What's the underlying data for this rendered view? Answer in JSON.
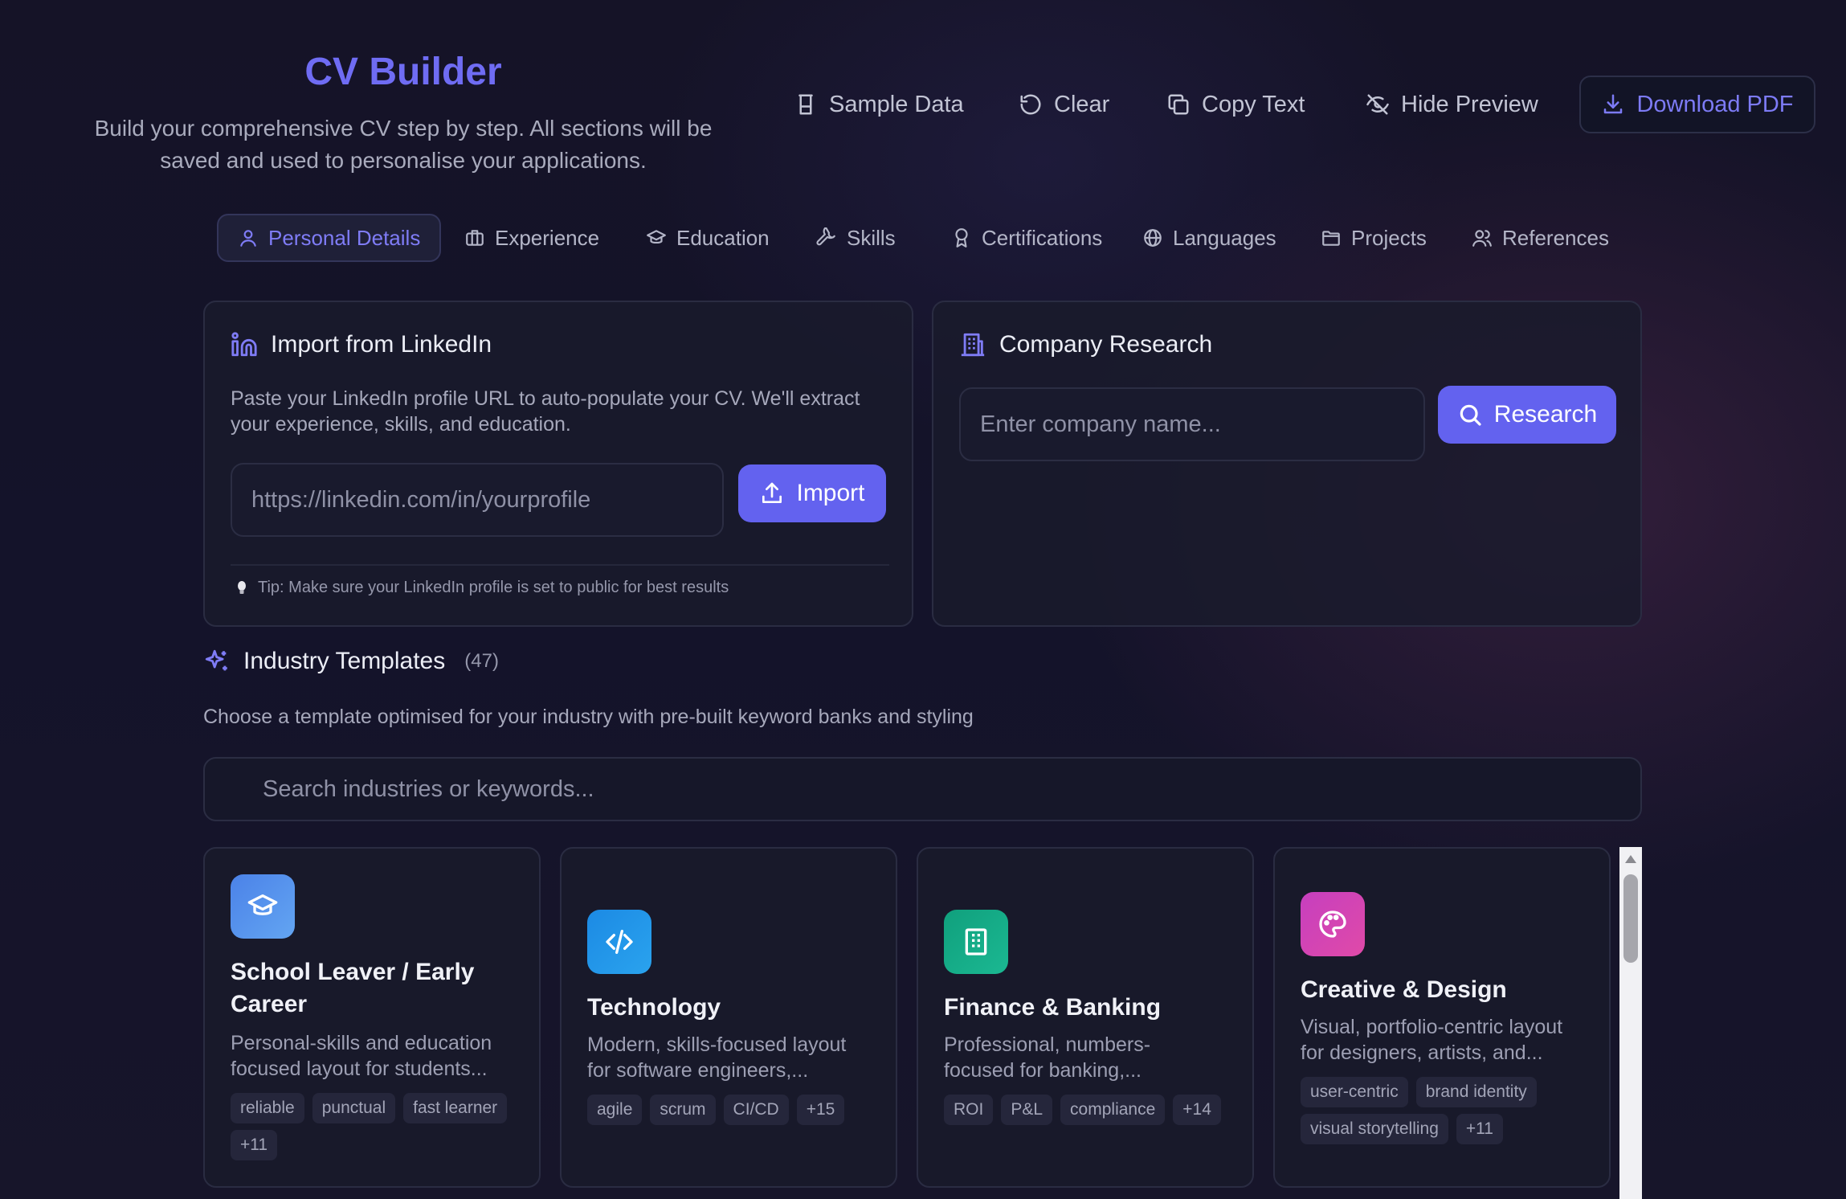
{
  "header": {
    "title": "CV Builder",
    "subtitle_line1": "Build your comprehensive CV step by step. All sections will be",
    "subtitle_line2": "saved and used to personalise your applications.",
    "actions": {
      "sample": "Sample Data",
      "clear": "Clear",
      "copy": "Copy Text",
      "hide": "Hide Preview",
      "download": "Download PDF"
    }
  },
  "tabs": [
    {
      "label": "Personal Details",
      "icon": "user-icon",
      "active": true
    },
    {
      "label": "Experience",
      "icon": "briefcase-icon"
    },
    {
      "label": "Education",
      "icon": "graduation-cap-icon"
    },
    {
      "label": "Skills",
      "icon": "wrench-icon"
    },
    {
      "label": "Certifications",
      "icon": "award-icon"
    },
    {
      "label": "Languages",
      "icon": "globe-icon"
    },
    {
      "label": "Projects",
      "icon": "folder-icon"
    },
    {
      "label": "References",
      "icon": "users-icon"
    }
  ],
  "linkedin": {
    "title": "Import from LinkedIn",
    "desc_line1": "Paste your LinkedIn profile URL to auto-populate your CV. We'll extract",
    "desc_line2": "your experience, skills, and education.",
    "placeholder": "https://linkedin.com/in/yourprofile",
    "button": "Import",
    "tip": "Tip: Make sure your LinkedIn profile is set to public for best results"
  },
  "research": {
    "title": "Company Research",
    "placeholder": "Enter company name...",
    "button": "Research"
  },
  "templates": {
    "title": "Industry Templates",
    "count": "(47)",
    "desc": "Choose a template optimised for your industry with pre-built keyword banks and styling",
    "search_placeholder": "Search industries or keywords...",
    "items": [
      {
        "name_line1": "School Leaver / Early",
        "name_line2": "Career",
        "desc_line1": "Personal-skills and education",
        "desc_line2": "focused layout for students...",
        "tags": [
          "reliable",
          "punctual",
          "fast learner",
          "+11"
        ],
        "icon": "graduation-cap-icon",
        "color": "#4f8fec"
      },
      {
        "name_line1": "Technology",
        "desc_line1": "Modern, skills-focused layout",
        "desc_line2": "for software engineers,...",
        "tags": [
          "agile",
          "scrum",
          "CI/CD",
          "+15"
        ],
        "icon": "code-icon",
        "color": "#1f93e6"
      },
      {
        "name_line1": "Finance & Banking",
        "desc_line1": "Professional, numbers-",
        "desc_line2": "focused for banking,...",
        "tags": [
          "ROI",
          "P&L",
          "compliance",
          "+14"
        ],
        "icon": "building-icon",
        "color": "#13a783"
      },
      {
        "name_line1": "Creative & Design",
        "desc_line1": "Visual, portfolio-centric layout",
        "desc_line2": "for designers, artists, and...",
        "tags": [
          "user-centric",
          "brand identity",
          "visual storytelling",
          "+11"
        ],
        "icon": "palette-icon",
        "color": "#cf3fb9"
      }
    ]
  },
  "colors": {
    "accent": "#6362ef",
    "background": "#14132a",
    "card": "#1a1b2c"
  }
}
